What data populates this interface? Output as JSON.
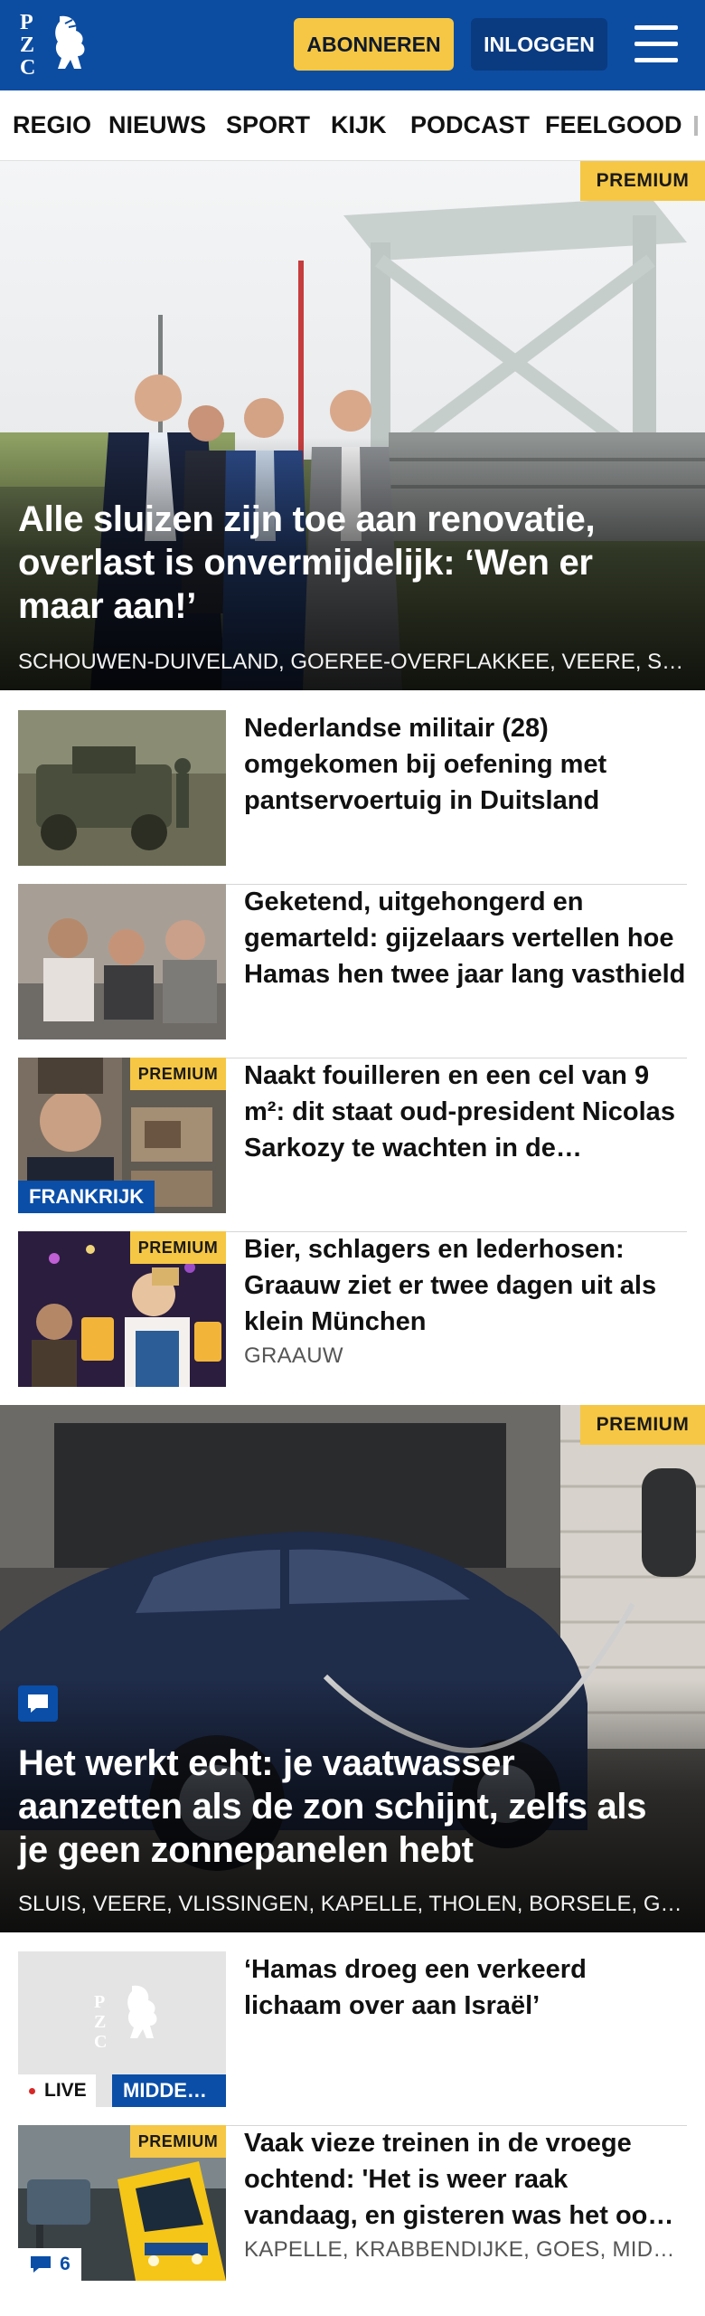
{
  "header": {
    "logo_letters": [
      "P",
      "Z",
      "C"
    ],
    "subscribe_label": "ABONNEREN",
    "login_label": "INLOGGEN"
  },
  "nav": {
    "items": [
      "REGIO",
      "NIEUWS",
      "SPORT",
      "KIJK",
      "PODCAST",
      "FEELGOOD"
    ]
  },
  "hero": {
    "badge": "PREMIUM",
    "title": "Alle sluizen zijn toe aan renovatie, overlast is onvermijdelijk: ‘Wen er maar aan!’",
    "locations": "SCHOUWEN-DUIVELAND, GOEREE-OVERFLAKKEE, VEERE, SLUIS"
  },
  "articles": [
    {
      "title": "Nederlandse militair (28) omgekomen bij oefening met pantservoertuig in Duitsland"
    },
    {
      "title": "Geketend, uitgehongerd en gemarteld: gijzelaars vertellen hoe Hamas hen twee jaar lang vasthield"
    },
    {
      "badge": "PREMIUM",
      "tag": "FRANKRIJK",
      "title": "Naakt fouilleren en een cel van 9 m²: dit staat oud-president Nicolas Sarkozy te wachten in de gevangenis"
    },
    {
      "badge": "PREMIUM",
      "title": "Bier, schlagers en lederhosen: Graauw ziet er twee dagen uit als klein München",
      "subtitle": "GRAAUW"
    }
  ],
  "hero2": {
    "badge": "PREMIUM",
    "title": "Het werkt echt: je vaatwasser aanzetten als de zon schijnt, zelfs als je geen zonnepanelen hebt",
    "locations": "SLUIS, VEERE, VLISSINGEN, KAPELLE, THOLEN, BORSELE, GOES"
  },
  "articles2": [
    {
      "live_label": "LIVE",
      "tag": "MIDDEN-OOSTEN",
      "title": "‘Hamas droeg een verkeerd lichaam over aan Israël’"
    },
    {
      "badge": "PREMIUM",
      "comment_count": "6",
      "title": "Vaak vieze treinen in de vroege ochtend: 'Het is weer raak vandaag, en gisteren was het ook zo'",
      "subtitle": "KAPELLE, KRABBENDIJKE, GOES, MIDDELBURG"
    }
  ],
  "colors": {
    "brand_blue": "#0c4da2",
    "premium_yellow": "#f6c744",
    "tag_blue": "#0a4ea8"
  },
  "icons": [
    "pzc-lion-logo",
    "menu-icon",
    "comment-icon",
    "live-dot-icon"
  ]
}
